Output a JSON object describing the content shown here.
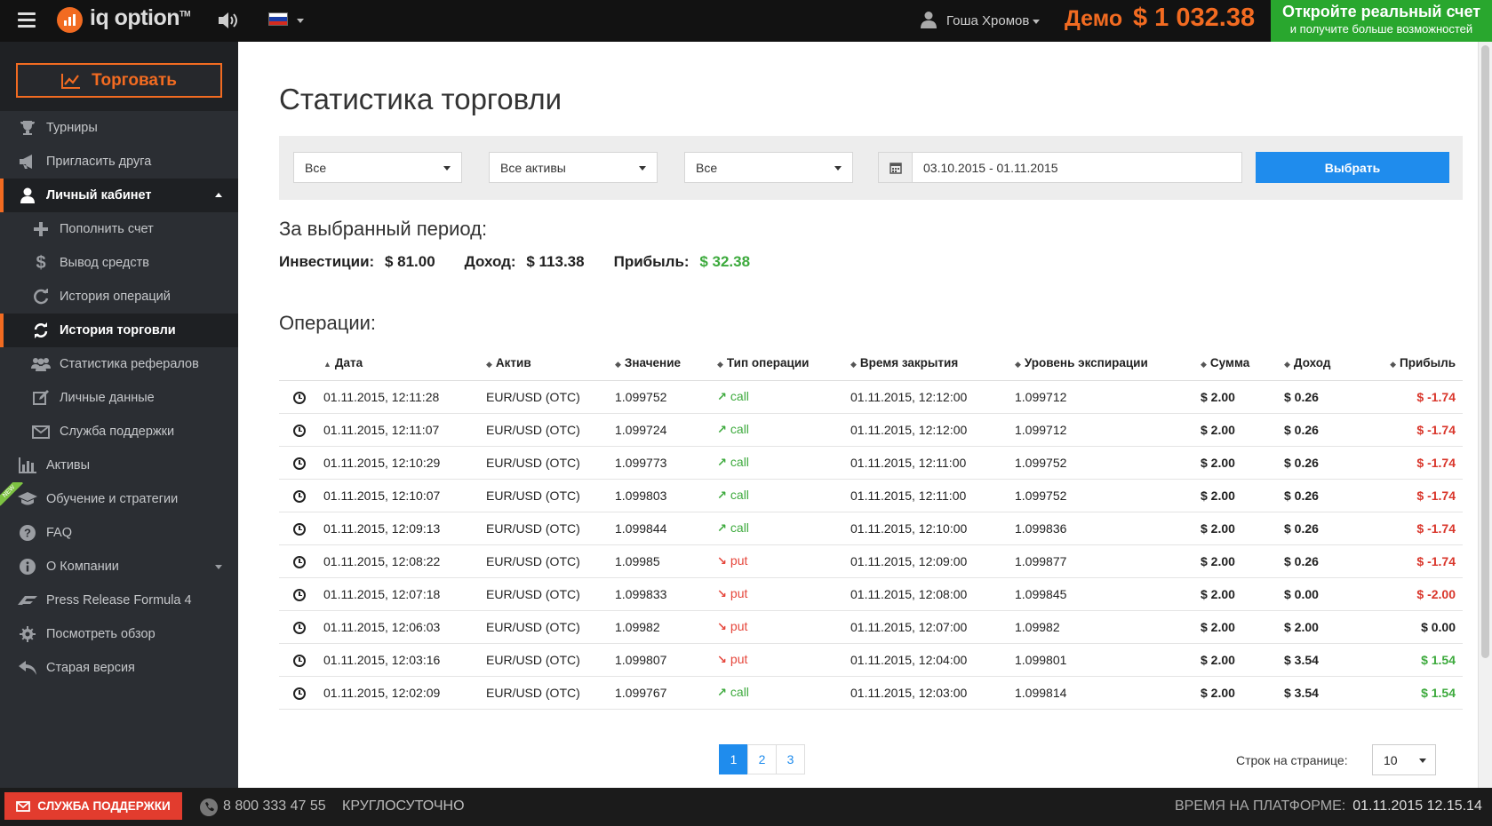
{
  "header": {
    "logo_text": "iq option",
    "logo_tm": "TM",
    "user_name": "Гоша Хромов",
    "demo_label": "Демо",
    "balance": "$ 1 032.38",
    "open_real_title": "Откройте реальный счет",
    "open_real_subtitle": "и получите больше возможностей",
    "accent_color": "#f26b21",
    "green_color": "#29a72e"
  },
  "sidebar": {
    "trade_label": "Торговать",
    "items": [
      {
        "label": "Турниры",
        "icon": "trophy-icon"
      },
      {
        "label": "Пригласить друга",
        "icon": "megaphone-icon"
      },
      {
        "label": "Личный кабинет",
        "icon": "user-icon"
      },
      {
        "label": "Пополнить счет",
        "icon": "plus-icon"
      },
      {
        "label": "Вывод средств",
        "icon": "dollar-icon"
      },
      {
        "label": "История операций",
        "icon": "refresh-icon"
      },
      {
        "label": "История торговли",
        "icon": "sync-icon"
      },
      {
        "label": "Статистика рефералов",
        "icon": "users-icon"
      },
      {
        "label": "Личные данные",
        "icon": "edit-icon"
      },
      {
        "label": "Служба поддержки",
        "icon": "envelope-icon"
      },
      {
        "label": "Активы",
        "icon": "bar-chart-icon"
      },
      {
        "label": "Обучение и стратегии",
        "icon": "graduation-cap-icon"
      },
      {
        "label": "FAQ",
        "icon": "question-icon"
      },
      {
        "label": "О Компании",
        "icon": "info-icon"
      },
      {
        "label": "Press Release Formula 4",
        "icon": "formula-icon"
      },
      {
        "label": "Посмотреть обзор",
        "icon": "cog-icon"
      },
      {
        "label": "Старая версия",
        "icon": "reply-icon"
      }
    ],
    "new_badge": "NEW"
  },
  "main": {
    "title": "Статистика торговли",
    "filters": {
      "type": "Все",
      "assets": "Все активы",
      "direction": "Все",
      "date_range": "03.10.2015 - 01.11.2015",
      "submit": "Выбрать"
    },
    "period_title": "За выбранный период:",
    "summary": {
      "invest_label": "Инвестиции:",
      "invest_value": "$ 81.00",
      "income_label": "Доход:",
      "income_value": "$ 113.38",
      "profit_label": "Прибыль:",
      "profit_value": "$ 32.38"
    },
    "ops_title": "Операции:",
    "columns": [
      "Дата",
      "Актив",
      "Значение",
      "Тип операции",
      "Время закрытия",
      "Уровень экспирации",
      "Сумма",
      "Доход",
      "Прибыль"
    ],
    "rows": [
      {
        "date": "01.11.2015, 12:11:28",
        "asset": "EUR/USD (OTC)",
        "value": "1.099752",
        "type": "call",
        "close": "01.11.2015, 12:12:00",
        "expiry": "1.099712",
        "amount": "$ 2.00",
        "income": "$ 0.26",
        "profit": "$ -1.74",
        "profit_sign": "neg"
      },
      {
        "date": "01.11.2015, 12:11:07",
        "asset": "EUR/USD (OTC)",
        "value": "1.099724",
        "type": "call",
        "close": "01.11.2015, 12:12:00",
        "expiry": "1.099712",
        "amount": "$ 2.00",
        "income": "$ 0.26",
        "profit": "$ -1.74",
        "profit_sign": "neg"
      },
      {
        "date": "01.11.2015, 12:10:29",
        "asset": "EUR/USD (OTC)",
        "value": "1.099773",
        "type": "call",
        "close": "01.11.2015, 12:11:00",
        "expiry": "1.099752",
        "amount": "$ 2.00",
        "income": "$ 0.26",
        "profit": "$ -1.74",
        "profit_sign": "neg"
      },
      {
        "date": "01.11.2015, 12:10:07",
        "asset": "EUR/USD (OTC)",
        "value": "1.099803",
        "type": "call",
        "close": "01.11.2015, 12:11:00",
        "expiry": "1.099752",
        "amount": "$ 2.00",
        "income": "$ 0.26",
        "profit": "$ -1.74",
        "profit_sign": "neg"
      },
      {
        "date": "01.11.2015, 12:09:13",
        "asset": "EUR/USD (OTC)",
        "value": "1.099844",
        "type": "call",
        "close": "01.11.2015, 12:10:00",
        "expiry": "1.099836",
        "amount": "$ 2.00",
        "income": "$ 0.26",
        "profit": "$ -1.74",
        "profit_sign": "neg"
      },
      {
        "date": "01.11.2015, 12:08:22",
        "asset": "EUR/USD (OTC)",
        "value": "1.09985",
        "type": "put",
        "close": "01.11.2015, 12:09:00",
        "expiry": "1.099877",
        "amount": "$ 2.00",
        "income": "$ 0.26",
        "profit": "$ -1.74",
        "profit_sign": "neg"
      },
      {
        "date": "01.11.2015, 12:07:18",
        "asset": "EUR/USD (OTC)",
        "value": "1.099833",
        "type": "put",
        "close": "01.11.2015, 12:08:00",
        "expiry": "1.099845",
        "amount": "$ 2.00",
        "income": "$ 0.00",
        "profit": "$ -2.00",
        "profit_sign": "neg"
      },
      {
        "date": "01.11.2015, 12:06:03",
        "asset": "EUR/USD (OTC)",
        "value": "1.09982",
        "type": "put",
        "close": "01.11.2015, 12:07:00",
        "expiry": "1.09982",
        "amount": "$ 2.00",
        "income": "$ 2.00",
        "profit": "$ 0.00",
        "profit_sign": "zero"
      },
      {
        "date": "01.11.2015, 12:03:16",
        "asset": "EUR/USD (OTC)",
        "value": "1.099807",
        "type": "put",
        "close": "01.11.2015, 12:04:00",
        "expiry": "1.099801",
        "amount": "$ 2.00",
        "income": "$ 3.54",
        "profit": "$ 1.54",
        "profit_sign": "pos"
      },
      {
        "date": "01.11.2015, 12:02:09",
        "asset": "EUR/USD (OTC)",
        "value": "1.099767",
        "type": "call",
        "close": "01.11.2015, 12:03:00",
        "expiry": "1.099814",
        "amount": "$ 2.00",
        "income": "$ 3.54",
        "profit": "$ 1.54",
        "profit_sign": "pos"
      }
    ],
    "pagination": {
      "pages": [
        "1",
        "2",
        "3"
      ],
      "current": "1"
    },
    "rows_per_page_label": "Строк на странице:",
    "rows_per_page": "10"
  },
  "footer": {
    "support_label": "СЛУЖБА ПОДДЕРЖКИ",
    "phone": "8 800 333 47 55",
    "hours": "КРУГЛОСУТОЧНО",
    "platform_time_label": "ВРЕМЯ НА ПЛАТФОРМЕ:",
    "platform_time": "01.11.2015 12.15.14"
  }
}
